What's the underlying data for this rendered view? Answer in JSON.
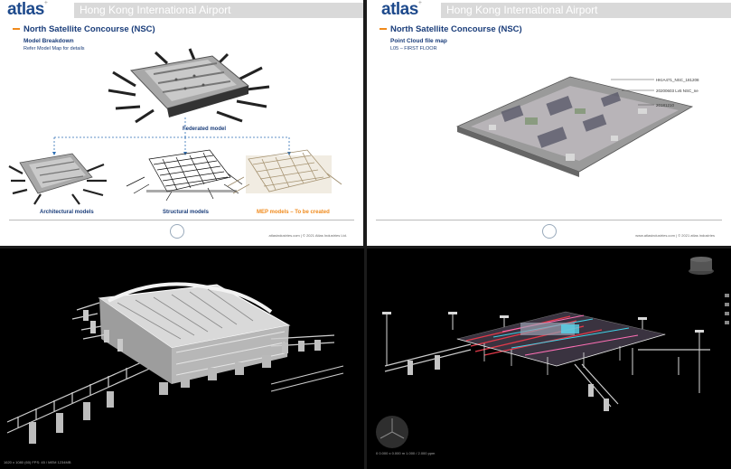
{
  "brand": {
    "logo_text": "atlas",
    "logo_sup": "+"
  },
  "header": {
    "title": "Hong Kong International Airport"
  },
  "slide_left": {
    "title": "North Satellite Concourse (NSC)",
    "subtitle": "Model Breakdown",
    "subline": "Refer Model Map for details",
    "federated_caption": "Federated model",
    "arch_caption": "Architectural models",
    "struct_caption": "Structural models",
    "mep_caption": "MEP models – To be created",
    "footer": "atlasindustries.com | © 2021 Atlas Industries Ltd."
  },
  "slide_right": {
    "title": "North Satellite Concourse (NSC)",
    "subtitle": "Point Cloud file map",
    "subline": "L05 – FIRST FLOOR",
    "labels": [
      "HKIA471_NSC_181208",
      "20200603 Lv5 NSC_ne",
      "20181210"
    ],
    "footer": "www.atlasindustries.com | © 2021 atlas industries"
  },
  "viewer_left": {
    "status": "1620 x 1080 (60) FPS: 45 / MEM 1234MB"
  },
  "viewer_right": {
    "status": "0 0.000 x 0.000 m   1.000 / 2.000 ppm"
  },
  "colors": {
    "brand_blue": "#1e4a8c",
    "accent_orange": "#f08a1c",
    "header_grey": "#d9d9d9"
  }
}
